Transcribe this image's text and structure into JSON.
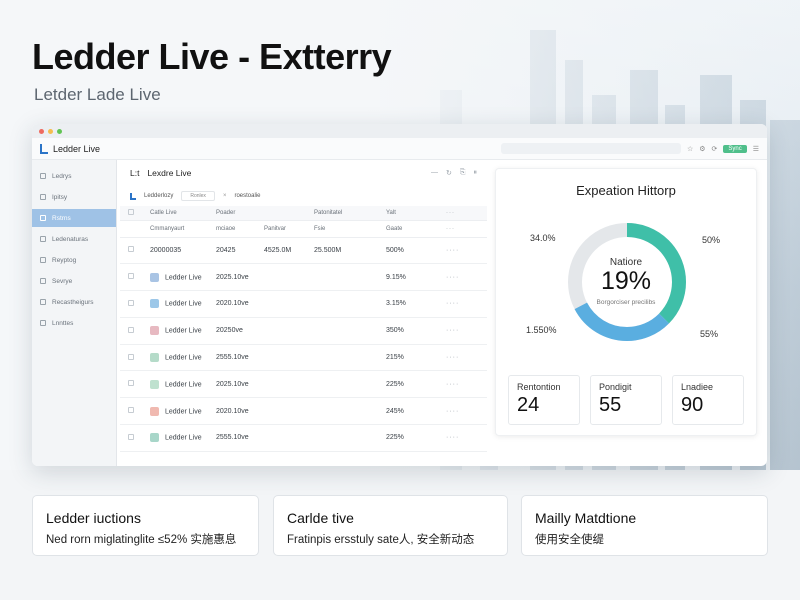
{
  "hero": {
    "title": "Ledder Live - Extterry",
    "subtitle": "Letder Lade Live"
  },
  "app": {
    "name": "Ledder Live",
    "badge": "Sync",
    "sidebar": [
      {
        "label": "Ledrys",
        "icon": "home-icon"
      },
      {
        "label": "Ipitsy",
        "icon": "chart-icon"
      },
      {
        "label": "Rstrns",
        "icon": "accounts-icon",
        "active": true
      },
      {
        "label": "Ledenaturas",
        "icon": "ledger-icon"
      },
      {
        "label": "Reyptog",
        "icon": "swap-icon"
      },
      {
        "label": "Sevrye",
        "icon": "services-icon"
      },
      {
        "label": "Recastheigurs",
        "icon": "settings-icon"
      },
      {
        "label": "Lnnttes",
        "icon": "limits-icon"
      }
    ],
    "main": {
      "logo": "L:t",
      "title": "Lexdre Live",
      "filter_label": "Ledderlozy",
      "filter_chip": "Ronlex",
      "filter_text": "roestoalie",
      "headers": [
        "Catle Live",
        "Poader",
        "Patonitatel",
        "Yalt"
      ],
      "subheaders": [
        "Cmmanyaurt",
        "mciaoe",
        "Panitvar",
        "Fsie",
        "Gaate"
      ],
      "first_row": [
        "20000035",
        "20425",
        "4525.0M",
        "25.500M",
        "500%"
      ],
      "rows": [
        {
          "name": "Ledder Live",
          "date": "2025.10ve",
          "pct": "9.15%",
          "color": "#a9c4e4"
        },
        {
          "name": "Ledder Live",
          "date": "2020.10ve",
          "pct": "3.15%",
          "color": "#9cc7e8"
        },
        {
          "name": "Ledder Live",
          "date": "20250ve",
          "pct": "350%",
          "color": "#e7b9c1"
        },
        {
          "name": "Ledder Live",
          "date": "2555.10ve",
          "pct": "215%",
          "color": "#b5dbc9"
        },
        {
          "name": "Ledder Live",
          "date": "2025.10ve",
          "pct": "225%",
          "color": "#bfe1cf"
        },
        {
          "name": "Ledder Live",
          "date": "2020.10ve",
          "pct": "245%",
          "color": "#f0b9b0"
        },
        {
          "name": "Ledder Live",
          "date": "2555.10ve",
          "pct": "225%",
          "color": "#a8d6c9"
        }
      ]
    },
    "panel": {
      "title": "Expeation Hittorp",
      "center_label": "Natiore",
      "center_value": "19%",
      "center_sub": "Borgorciser precilibs",
      "labels": {
        "top_left": "34.0%",
        "top_right": "50%",
        "bottom_left": "1.550%",
        "bottom_right": "55%"
      },
      "stats": [
        {
          "label": "Rentontion",
          "value": "24"
        },
        {
          "label": "Pondigit",
          "value": "55"
        },
        {
          "label": "Lnadiee",
          "value": "90"
        }
      ],
      "colors": {
        "teal": "#3fbfa8",
        "blue": "#5aaee0",
        "grey": "#e4e7ea"
      }
    }
  },
  "cards": [
    {
      "title": "Ledder iuctions",
      "desc": "Ned rorn miglatinglite ≤52% 实施惠息"
    },
    {
      "title": "Carlde tive",
      "desc": "Fratinpis ersstuly sate人, 安全新动态"
    },
    {
      "title": "Mailly Matdtione",
      "desc": "使用安全使缇"
    }
  ]
}
